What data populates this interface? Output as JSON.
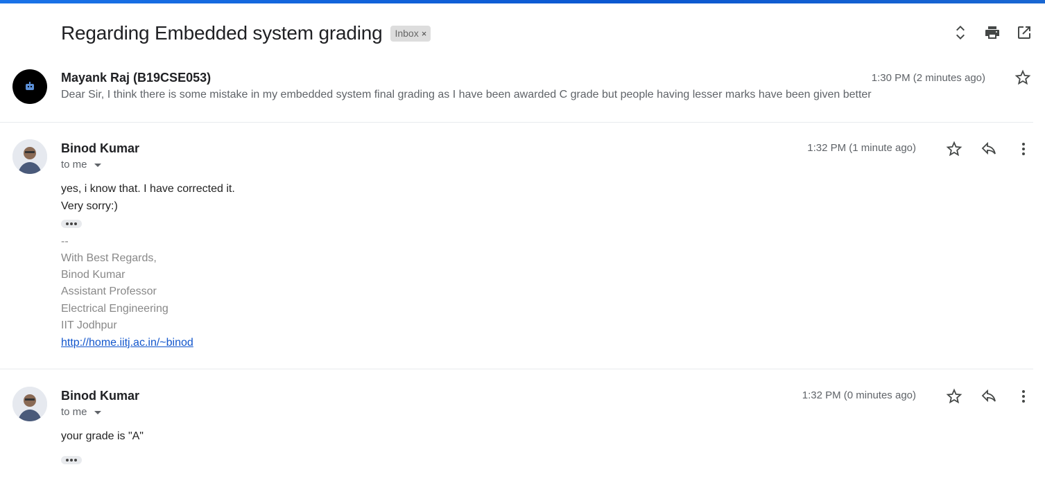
{
  "thread": {
    "subject": "Regarding Embedded system grading",
    "label": "Inbox",
    "label_remove": "×"
  },
  "messages": [
    {
      "sender": "Mayank Raj (B19CSE053)",
      "time": "1:30 PM (2 minutes ago)",
      "snippet": "Dear Sir, I think there is some mistake in my embedded system final grading as I have been awarded C grade but people having lesser marks have been given better"
    },
    {
      "sender": "Binod Kumar",
      "recipient": "to me",
      "time": "1:32 PM (1 minute ago)",
      "body": [
        "yes, i know that.  I have corrected it.",
        "Very sorry:)"
      ],
      "signature": [
        "--",
        "With Best Regards,",
        "Binod Kumar",
        "Assistant Professor",
        "Electrical Engineering",
        "IIT Jodhpur"
      ],
      "link": "http://home.iitj.ac.in/~binod"
    },
    {
      "sender": "Binod Kumar",
      "recipient": "to me",
      "time": "1:32 PM (0 minutes ago)",
      "body": [
        "your grade is \"A\""
      ]
    }
  ],
  "icons": {
    "expand": "unfold-more-icon",
    "print": "print-icon",
    "open_new": "open-in-new-icon",
    "star": "star-icon",
    "reply": "reply-icon",
    "more": "more-vert-icon"
  },
  "colors": {
    "accent": "#1a73e8",
    "link": "#1155cc",
    "chip_bg": "#dddddd"
  }
}
